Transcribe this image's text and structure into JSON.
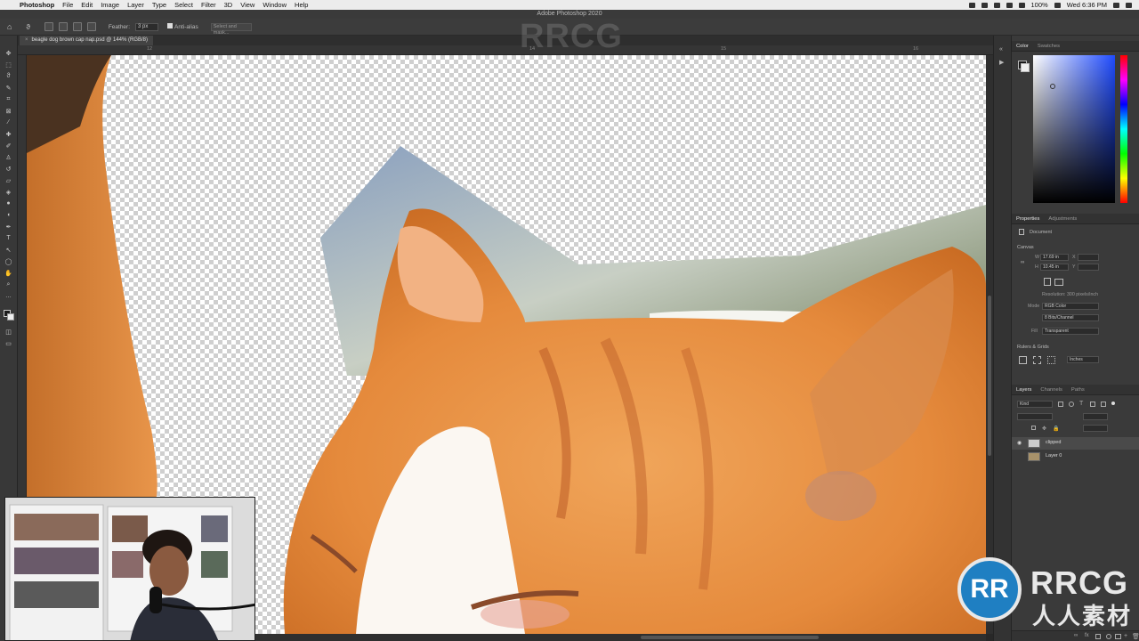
{
  "menubar": {
    "app_name": "Photoshop",
    "items": [
      "File",
      "Edit",
      "Image",
      "Layer",
      "Type",
      "Select",
      "Filter",
      "3D",
      "View",
      "Window",
      "Help"
    ],
    "battery": "100%",
    "clock": "Wed 6:36 PM"
  },
  "window": {
    "title": "Adobe Photoshop 2020"
  },
  "options_bar": {
    "feather_label": "Feather:",
    "feather_value": "3 px",
    "anti_alias_label": "Anti-alias",
    "select_mask_label": "Select and mask..."
  },
  "document": {
    "tab_close": "×",
    "tab_label": "beagle dog brown cap nap.psd @ 144% (RGB/8)"
  },
  "ruler": {
    "labels": [
      "12",
      "14",
      "15",
      "16"
    ]
  },
  "panels": {
    "color_tabs": [
      "Color",
      "Swatches"
    ],
    "properties_tabs": [
      "Properties",
      "Adjustments"
    ],
    "properties_section": "Document",
    "canvas_header": "Canvas",
    "width_label": "W",
    "width_value": "17.69 in",
    "height_label": "H",
    "height_value": "10.45 in",
    "x_label": "X",
    "y_label": "Y",
    "resolution": "Resolution: 300 pixels/inch",
    "mode_label": "Mode",
    "mode_value": "RGB Color",
    "bits_value": "8 Bits/Channel",
    "fill_label": "Fill",
    "fill_value": "Transparent",
    "rulers_header": "Rulers & Grids",
    "rulers_unit": "Inches",
    "layers_tabs": [
      "Layers",
      "Channels",
      "Paths"
    ],
    "layers_filter": "Kind",
    "layers": [
      {
        "name": "clipped",
        "visible": true
      },
      {
        "name": "Layer 0",
        "visible": false
      }
    ]
  },
  "watermark": {
    "top": "RRCG",
    "brand": "RRCG",
    "sub": "人人素材",
    "logo": "RR"
  },
  "colors": {
    "menubar_bg": "#ececec",
    "panel_bg": "#3a3a3a",
    "cat_orange": "#e58a3c",
    "watermark_blue": "#1f7fc2"
  }
}
